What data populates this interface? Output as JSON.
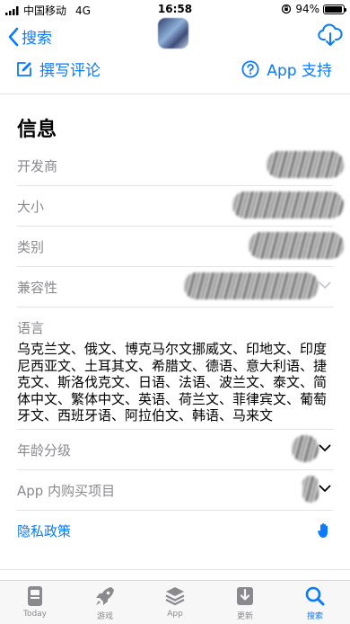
{
  "status_bar": {
    "carrier": "中国移动",
    "network": "4G",
    "time": "16:58",
    "battery_percent": "94%",
    "battery_level": 0.94
  },
  "nav": {
    "back_label": "搜索"
  },
  "actions": {
    "write_review": "撰写评论",
    "app_support": "App 支持"
  },
  "info": {
    "title": "信息",
    "rows": [
      {
        "label": "开发商"
      },
      {
        "label": "大小"
      },
      {
        "label": "类别"
      },
      {
        "label": "兼容性"
      }
    ],
    "language_label": "语言",
    "language_value": "乌克兰文、俄文、博克马尔文挪威文、印地文、印度尼西亚文、土耳其文、希腊文、德语、意大利语、捷克文、斯洛伐克文、日语、法语、波兰文、泰文、简体中文、繁体中文、英语、荷兰文、菲律宾文、葡萄牙文、西班牙语、阿拉伯文、韩语、马来文",
    "age_rating_label": "年龄分级",
    "in_app_label": "App 内购买项目",
    "privacy_label": "隐私政策"
  },
  "tabs": [
    {
      "label": "Today",
      "icon": "today-icon"
    },
    {
      "label": "游戏",
      "icon": "rocket-icon"
    },
    {
      "label": "App",
      "icon": "layers-icon"
    },
    {
      "label": "更新",
      "icon": "download-tray-icon"
    },
    {
      "label": "搜索",
      "icon": "search-icon",
      "active": true
    }
  ],
  "colors": {
    "accent": "#0a7aff",
    "secondary_text": "#8a8a8e",
    "separator": "#e3e3e6",
    "tab_bar_bg": "#f7f7f7"
  }
}
